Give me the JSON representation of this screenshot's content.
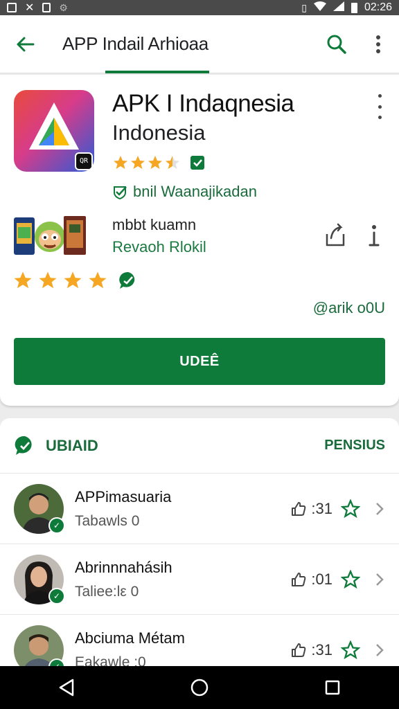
{
  "status_bar": {
    "time": "02:26"
  },
  "app_bar": {
    "title": "APP Indail Arhioaa"
  },
  "app": {
    "title": "APK I Indaqnesia",
    "subtitle": "Indonesia",
    "icon_badge": "QR",
    "rating_stars": 3.5,
    "verified_text": "bnil Waanajikadan",
    "related_title": "mbbt kuamn",
    "related_link": "Revaoh Rlokil",
    "big_stars": 4,
    "handle": "@arik o0U",
    "cta_label": "UDEÊ"
  },
  "list": {
    "title": "UBIAID",
    "action": "PENSIUS",
    "items": [
      {
        "name": "APPimasuaria",
        "sub": "Tabawls 0",
        "count": ":31"
      },
      {
        "name": "Abrinnnahásih",
        "sub": "Taliee:lε 0",
        "count": ":01"
      },
      {
        "name": "Abciuma Métam",
        "sub": "Eakawle :0",
        "count": ":31"
      }
    ]
  },
  "colors": {
    "accent": "#0f7b3a",
    "star": "#f5a623",
    "status_bar": "#4a4a4a"
  }
}
